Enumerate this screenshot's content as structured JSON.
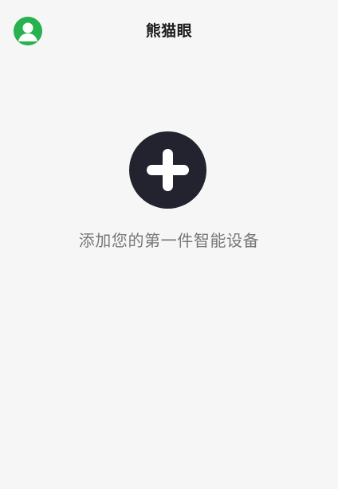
{
  "header": {
    "title": "熊猫眼",
    "avatar_icon": "user-avatar-icon"
  },
  "main": {
    "add_icon": "plus-icon",
    "empty_message": "添加您的第一件智能设备"
  },
  "colors": {
    "background": "#f6f6f6",
    "avatar": "#27b14f",
    "add_button": "#23232f",
    "title": "#1c1c1c",
    "message": "#777777"
  }
}
